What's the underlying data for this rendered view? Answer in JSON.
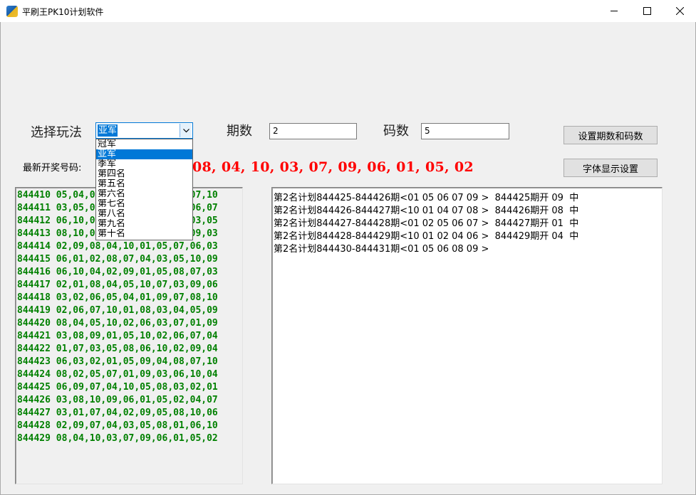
{
  "window": {
    "title": "平刷王PK10计划软件",
    "icon": "app-icon",
    "controls": [
      "minimize-icon",
      "maximize-icon",
      "close-icon"
    ]
  },
  "form": {
    "play_label": "选择玩法",
    "play_selected": "亚军",
    "play_options": [
      "冠军",
      "亚军",
      "季军",
      "第四名",
      "第五名",
      "第六名",
      "第七名",
      "第八名",
      "第九名",
      "第十名"
    ],
    "periods_label": "期数",
    "periods_value": "2",
    "codes_label": "码数",
    "codes_value": "5",
    "set_button": "设置期数和码数",
    "font_button": "字体显示设置",
    "latest_label": "最新开奖号码:",
    "latest_numbers": "08, 04, 10, 03, 07, 09, 06, 01, 05, 02"
  },
  "history": [
    "844410 05,04,03,08,01,09,06,02,07,10",
    "844411 03,05,02,09,04,10,08,01,06,07",
    "844412 06,10,07,08,04,02,01,09,03,05",
    "844413 08,10,01,04,06,05,07,02,09,03",
    "844414 02,09,08,04,10,01,05,07,06,03",
    "844415 06,01,02,08,07,04,03,05,10,09",
    "844416 06,10,04,02,09,01,05,08,07,03",
    "844417 02,01,08,04,05,10,07,03,09,06",
    "844418 03,02,06,05,04,01,09,07,08,10",
    "844419 02,06,07,10,01,08,03,04,05,09",
    "844420 08,04,05,10,02,06,03,07,01,09",
    "844421 03,08,09,01,05,10,02,06,07,04",
    "844422 01,07,03,05,08,06,10,02,09,04",
    "844423 06,03,02,01,05,09,04,08,07,10",
    "844424 08,02,05,07,01,09,03,06,10,04",
    "844425 06,09,07,04,10,05,08,03,02,01",
    "844426 03,08,10,09,06,01,05,02,04,07",
    "844427 03,01,07,04,02,09,05,08,10,06",
    "844428 02,09,07,04,03,05,08,01,06,10",
    "844429 08,04,10,03,07,09,06,01,05,02"
  ],
  "plans": [
    "第2名计划844425-844426期<01 05 06 07 09 >  844425期开 09  中",
    "第2名计划844426-844427期<10 01 04 07 08 >  844426期开 08  中",
    "第2名计划844427-844428期<01 02 05 06 07 >  844427期开 01  中",
    "第2名计划844428-844429期<10 01 02 04 06 >  844429期开 04  中",
    "第2名计划844430-844431期<01 05 06 08 09 >"
  ]
}
